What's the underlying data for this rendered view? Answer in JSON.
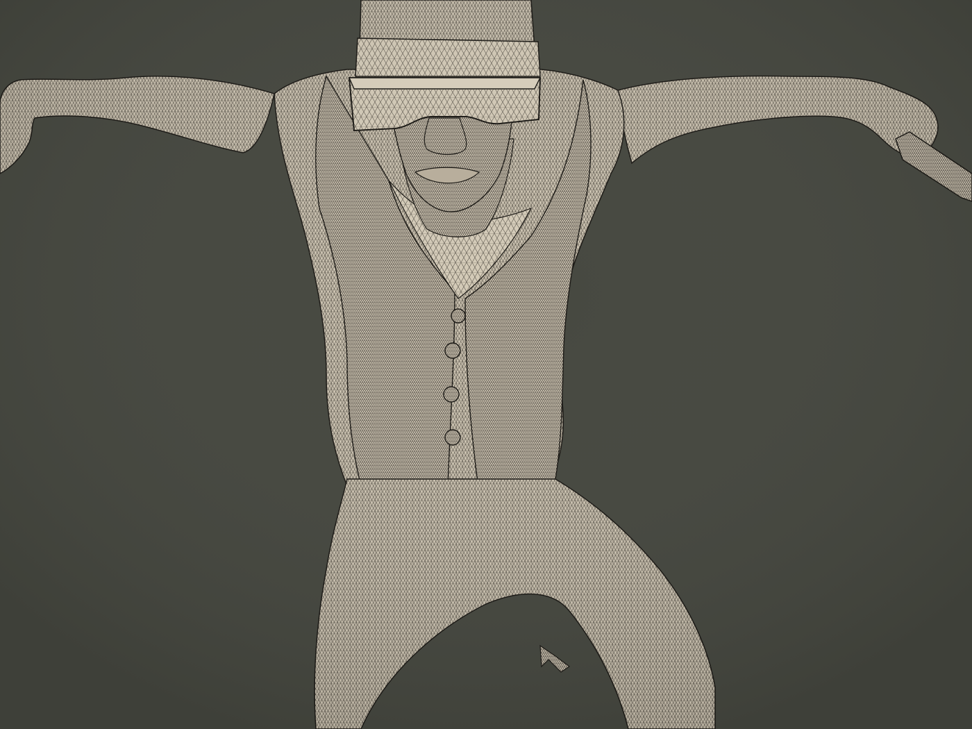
{
  "viewport": {
    "background_color": "#45473f",
    "mesh_fill_color": "#cfc6b4",
    "mesh_shade_color": "#a99f8c",
    "wire_color": "#1e1c18",
    "render_mode": "wireframe-on-shaded",
    "subject": "3d-character-mesh"
  }
}
